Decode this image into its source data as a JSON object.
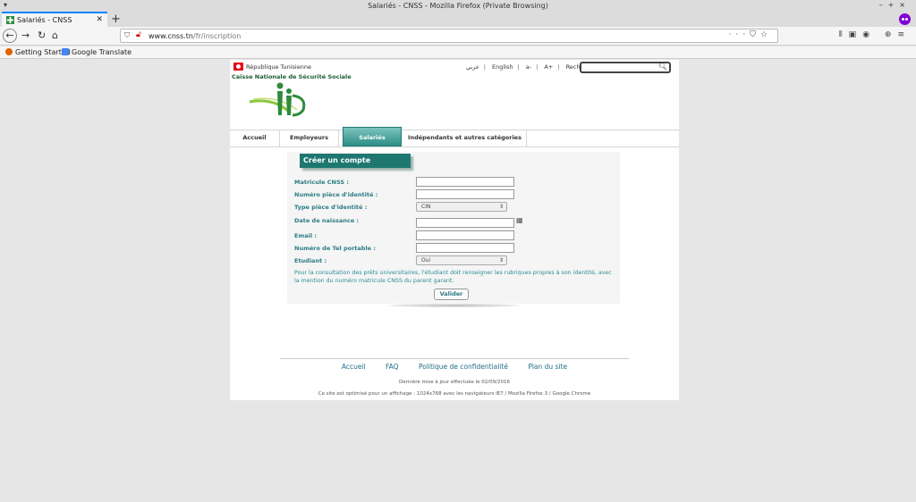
{
  "window": {
    "title": "Salariés - CNSS - Mozilla Firefox (Private Browsing)"
  },
  "tab": {
    "label": "Salariés - CNSS"
  },
  "address": {
    "domain": "www.cnss.tn",
    "path": "/fr/inscription"
  },
  "bookmarks": [
    {
      "label": "Getting Started"
    },
    {
      "label": "Google Translate"
    }
  ],
  "header": {
    "republic": "République Tunisienne",
    "org_name": "Caisse Nationale de Sécurité Sociale",
    "links": {
      "arabic": "عربي",
      "english": "English",
      "font_smaller": "a-",
      "font_larger": "A+",
      "search_label": "Rechercher"
    }
  },
  "menu": [
    {
      "label": "Accueil"
    },
    {
      "label": "Employeurs"
    },
    {
      "label": "Salariés"
    },
    {
      "label": "Indépendants et autres catégories"
    }
  ],
  "form": {
    "title": "Créer un compte",
    "fields": {
      "matricule": "Matricule CNSS :",
      "piece_num": "Numéro pièce d'identité :",
      "piece_type": "Type pièce d'identité :",
      "piece_type_value": "CIN",
      "birth_date": "Date de naissance :",
      "email": "Email :",
      "phone": "Numéro de Tel portable :",
      "student": "Etudiant :",
      "student_value": "Oui"
    },
    "note": "Pour la consultation des prêts universitaires, l'étudiant doit renseigner les rubriques propres à son identité, avec la mention du numéro matricule CNSS du parent garant.",
    "submit": "Valider"
  },
  "footer": {
    "links": [
      "Accueil",
      "FAQ",
      "Politique de confidentialité",
      "Plan du site"
    ],
    "update": "Dernière mise à jour effectuée le 02/09/2016",
    "optimized": "Ce site est optimisé pour un affichage : 1024x768 avec les navigateurs IE7 / Mozilla Firefox 3 / Google Chrome"
  }
}
